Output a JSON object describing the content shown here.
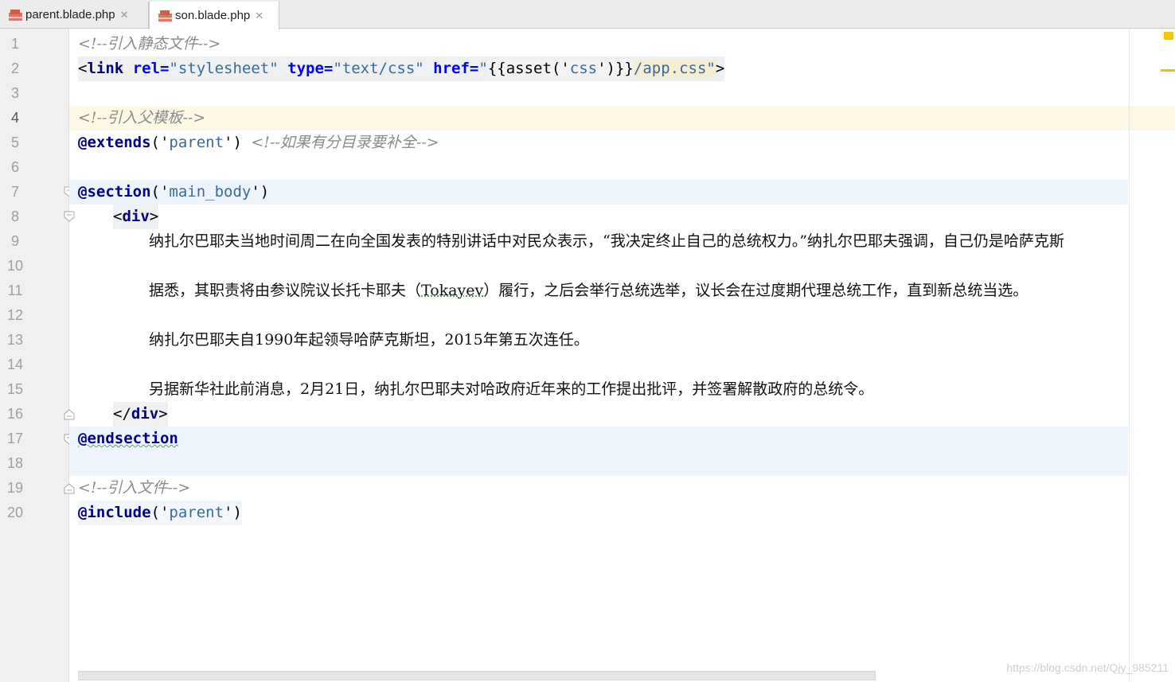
{
  "tabs": [
    {
      "label": "parent.blade.php",
      "active": false
    },
    {
      "label": "son.blade.php",
      "active": true
    }
  ],
  "line_numbers": [
    "1",
    "2",
    "3",
    "4",
    "5",
    "6",
    "7",
    "8",
    "9",
    "10",
    "11",
    "12",
    "13",
    "14",
    "15",
    "16",
    "17",
    "18",
    "19",
    "20"
  ],
  "code": {
    "l1_comment": "<!--引入静态文件-->",
    "l2": {
      "lt": "<",
      "tag": "link",
      "rel_attr": " rel=",
      "rel_val": "\"stylesheet\"",
      "type_attr": " type=",
      "type_val": "\"text/css\"",
      "href_attr": " href=",
      "href_q": "\"",
      "asset_call": "{{asset('",
      "asset_arg": "css",
      "asset_close": "')}}",
      "path": "/app.css",
      "end_q": "\"",
      "gt": ">"
    },
    "l4_comment": "<!--引入父模板-->",
    "l5": {
      "directive": "@extends",
      "open": "('",
      "arg": "parent",
      "close": "')",
      "comment": "<!--如果有分目录要补全-->"
    },
    "l7": {
      "directive": "@section",
      "open": "('",
      "arg": "main_body",
      "close": "')"
    },
    "l8": {
      "lt": "<",
      "tag": "div",
      "gt": ">"
    },
    "l9_text": "纳扎尔巴耶夫当地时间周二在向全国发表的特别讲话中对民众表示，“我决定终止自己的总统权力。”纳扎尔巴耶夫强调，自己仍是哈萨克斯",
    "l11": {
      "before": "据悉，其职责将由参议院议长托卡耶夫（",
      "word": "Tokayev",
      "after": "）履行，之后会举行总统选举，议长会在过度期代理总统工作，直到新总统当选。"
    },
    "l13_text": "纳扎尔巴耶夫自1990年起领导哈萨克斯坦，2015年第五次连任。",
    "l15_text": "另据新华社此前消息，2月21日，纳扎尔巴耶夫对哈政府近年来的工作提出批评，并签署解散政府的总统令。",
    "l16": {
      "lt": "</",
      "tag": "div",
      "gt": ">"
    },
    "l17_directive": "@endsection",
    "l19_comment": "<!--引入文件-->",
    "l20": {
      "directive": "@include",
      "open": "('",
      "arg": "parent",
      "close": "')"
    }
  },
  "watermark": "https://blog.csdn.net/Qjy_985211"
}
